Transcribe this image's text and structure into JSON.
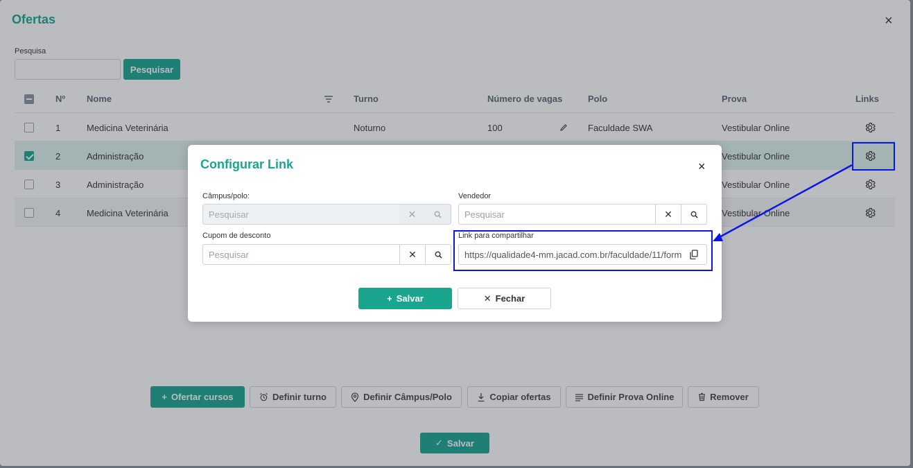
{
  "outer": {
    "title": "Ofertas",
    "close_icon": "×",
    "search": {
      "label": "Pesquisa",
      "value": "",
      "button": "Pesquisar"
    },
    "table": {
      "headers": {
        "check": "",
        "num": "Nº",
        "name": "Nome",
        "turno": "Turno",
        "vagas": "Número de vagas",
        "polo": "Polo",
        "prova": "Prova",
        "links": "Links"
      },
      "rows": [
        {
          "num": "1",
          "name": "Medicina Veterinária",
          "turno": "Noturno",
          "vagas": "100",
          "polo": "Faculdade SWA",
          "prova": "Vestibular Online",
          "checked": false
        },
        {
          "num": "2",
          "name": "Administração",
          "turno": "",
          "vagas": "",
          "polo": "",
          "prova": "Vestibular Online",
          "checked": true
        },
        {
          "num": "3",
          "name": "Administração",
          "turno": "",
          "vagas": "",
          "polo": "",
          "prova": "Vestibular Online",
          "checked": false
        },
        {
          "num": "4",
          "name": "Medicina Veterinária",
          "turno": "",
          "vagas": "",
          "polo": "",
          "prova": "Vestibular Online",
          "checked": false
        }
      ]
    },
    "actions": {
      "ofertar": "Ofertar cursos",
      "turno": "Definir turno",
      "campus": "Definir Câmpus/Polo",
      "copiar": "Copiar ofertas",
      "prova": "Definir Prova Online",
      "remover": "Remover"
    },
    "save": "Salvar"
  },
  "modal": {
    "title": "Configurar Link",
    "close_icon": "×",
    "campus": {
      "label": "Câmpus/polo:",
      "placeholder": "Pesquisar"
    },
    "vendedor": {
      "label": "Vendedor",
      "placeholder": "Pesquisar"
    },
    "cupom": {
      "label": "Cupom de desconto",
      "placeholder": "Pesquisar"
    },
    "link": {
      "label": "Link para compartilhar",
      "value": "https://qualidade4-mm.jacad.com.br/faculdade/11/form"
    },
    "save": "Salvar",
    "close": "Fechar"
  },
  "colors": {
    "accent": "#1aa58f",
    "highlight": "#0a17e0"
  }
}
